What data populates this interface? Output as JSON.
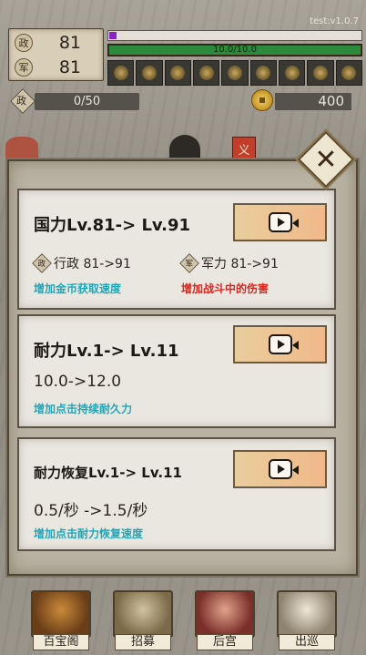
{
  "version": "test:v1.0.7",
  "stats": {
    "admin_emblem": "政",
    "admin_value": "81",
    "military_emblem": "军",
    "military_value": "81"
  },
  "progress": {
    "purple_fraction": 0.03,
    "stamina_text": "10.0/10.0",
    "stamina_fraction": 1.0
  },
  "resources": {
    "admin_emblem": "政",
    "left_value": "0/50",
    "gold_value": "400"
  },
  "deco": {
    "banner_char": "义"
  },
  "dialog": {
    "close_label": "✕",
    "cards": [
      {
        "title": "国力Lv.81-> Lv.91",
        "sub_left_emblem": "政",
        "sub_left": "行政 81->91",
        "sub_right_emblem": "军",
        "sub_right": "军力 81->91",
        "desc_left": "增加金币获取速度",
        "desc_right": "增加战斗中的伤害"
      },
      {
        "title": "耐力Lv.1-> Lv.11",
        "value": "10.0->12.0",
        "desc": "增加点击持续耐久力"
      },
      {
        "title": "耐力恢复Lv.1-> Lv.11",
        "value": "0.5/秒 ->1.5/秒",
        "desc": "增加点击耐力恢复速度"
      }
    ]
  },
  "nav": {
    "items": [
      "百宝阁",
      "招募",
      "后宫",
      "出巡"
    ]
  }
}
